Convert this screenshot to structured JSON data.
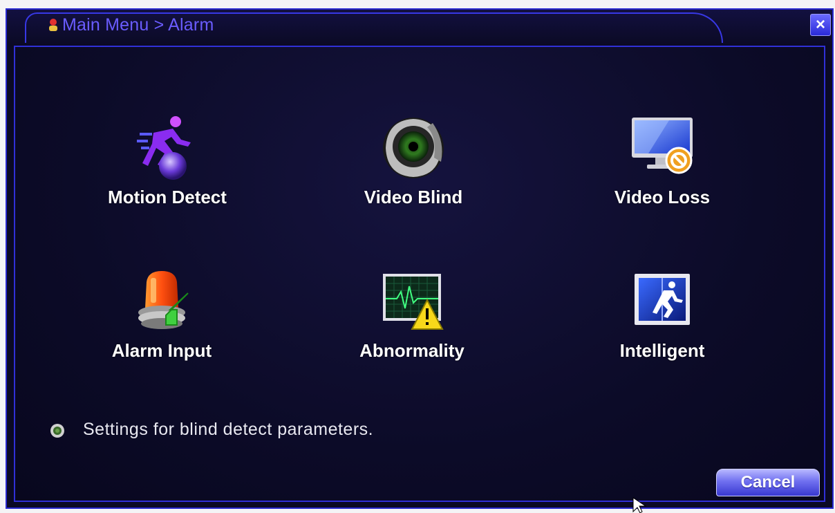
{
  "window": {
    "title": "Main Menu > Alarm",
    "close_label": "×"
  },
  "menu": {
    "items": [
      {
        "label": "Motion Detect",
        "icon": "motion-detect-icon"
      },
      {
        "label": "Video Blind",
        "icon": "video-blind-icon"
      },
      {
        "label": "Video Loss",
        "icon": "video-loss-icon"
      },
      {
        "label": "Alarm Input",
        "icon": "alarm-input-icon"
      },
      {
        "label": "Abnormality",
        "icon": "abnormality-icon"
      },
      {
        "label": "Intelligent",
        "icon": "intelligent-icon"
      }
    ]
  },
  "status": {
    "text": "Settings for blind detect parameters."
  },
  "buttons": {
    "cancel_label": "Cancel"
  },
  "colors": {
    "background": "#0b0a24",
    "border": "#2a2ad0",
    "title_text": "#6a5cff",
    "label_text": "#ffffff",
    "button": "#5a5aee"
  }
}
